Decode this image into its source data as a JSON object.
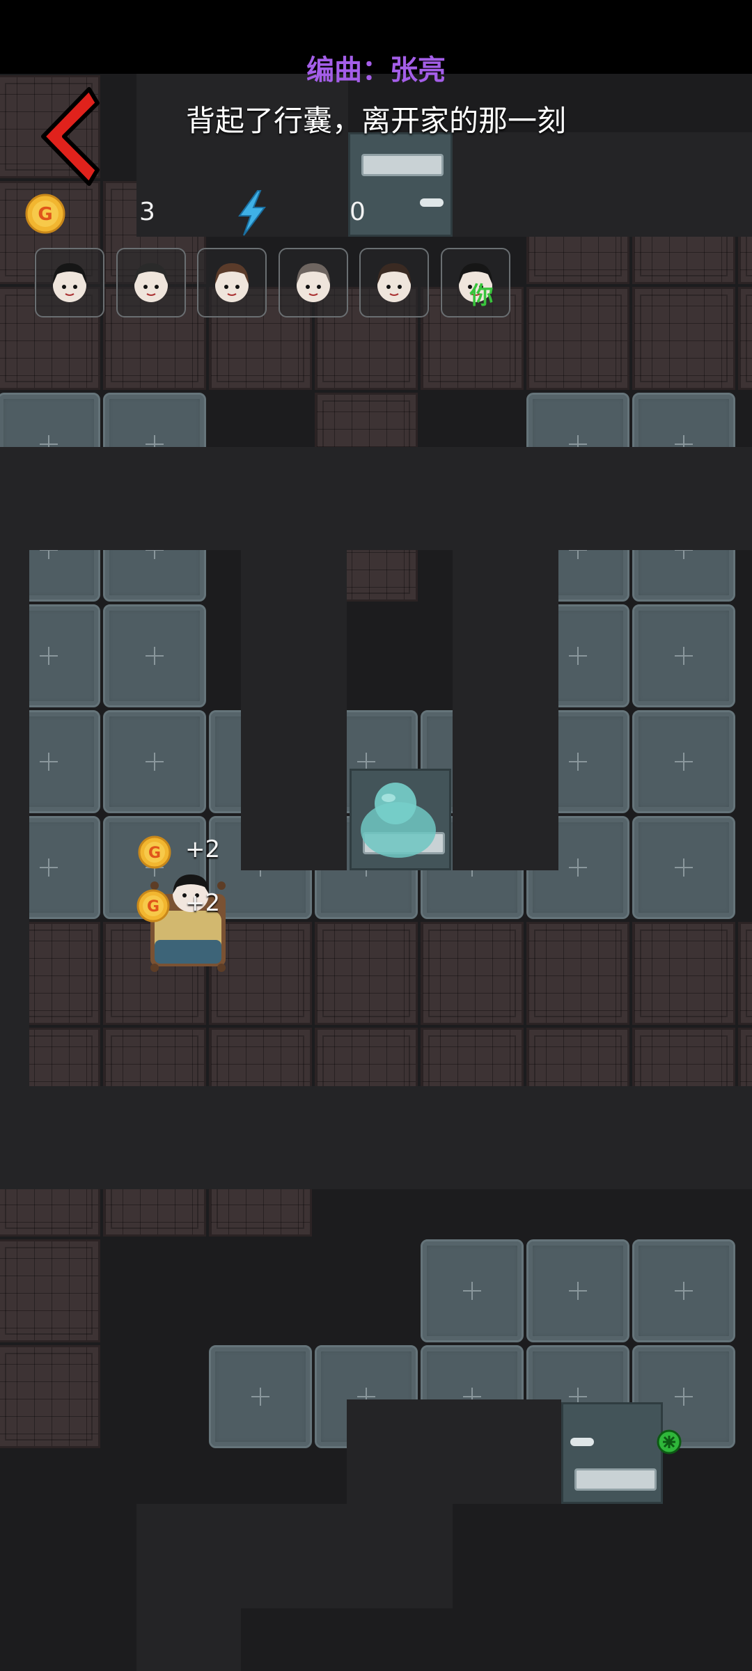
{
  "header": {
    "song_credit": "编曲：张亮",
    "song_line": "背起了行囊，离开家的那一刻"
  },
  "hud": {
    "coin_icon": "gold-coin-icon",
    "coin_count": "3",
    "energy_icon": "lightning-bolt-icon",
    "energy_count": "0"
  },
  "players": [
    {
      "avatar": "girl-with-pigtails-avatar"
    },
    {
      "avatar": "ghost-boy-avatar"
    },
    {
      "avatar": "brown-hair-girl-avatar"
    },
    {
      "avatar": "grey-hair-girl-avatar"
    },
    {
      "avatar": "short-hair-girl-avatar"
    },
    {
      "avatar": "girl-with-pigtails-avatar",
      "you_label": "你"
    }
  ],
  "popups": [
    {
      "label": "+2"
    },
    {
      "label": "+2"
    }
  ],
  "colors": {
    "credit": "#a45ee8",
    "you": "#39c43d",
    "back_arrow": "#e0221c"
  }
}
